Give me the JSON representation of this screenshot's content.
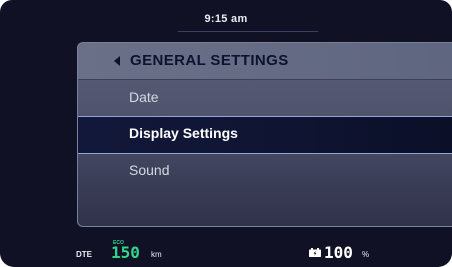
{
  "status": {
    "time": "9:15 am"
  },
  "menu": {
    "title": "GENERAL SETTINGS",
    "items": [
      {
        "label": "Date",
        "selected": false
      },
      {
        "label": "Display Settings",
        "selected": true
      },
      {
        "label": "Sound",
        "selected": false
      }
    ]
  },
  "footer": {
    "dte_label": "DTE",
    "mode": "ECO",
    "range_value": "150",
    "range_unit": "km",
    "battery_value": "100",
    "battery_unit": "%"
  },
  "colors": {
    "background": "#101124",
    "accent_green": "#2fd78c",
    "selected_row": "#0f1431",
    "highlight_border": "#93a4d8"
  },
  "icons": {
    "back": "triangle-left-icon",
    "battery": "battery-icon"
  }
}
